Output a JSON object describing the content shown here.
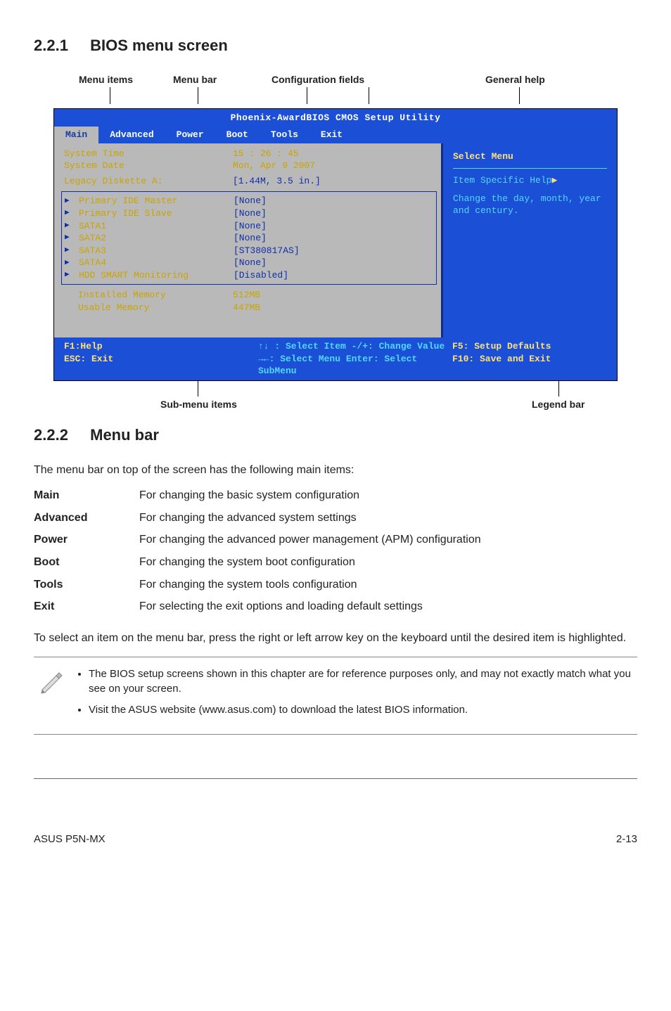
{
  "section_2_2_1": {
    "num": "2.2.1",
    "title": "BIOS menu screen"
  },
  "callouts": {
    "menu_items": "Menu items",
    "menu_bar": "Menu bar",
    "config_fields": "Configuration fields",
    "general_help": "General help",
    "sub_menu": "Sub-menu items",
    "legend": "Legend bar"
  },
  "bios": {
    "title": "Phoenix-AwardBIOS CMOS Setup Utility",
    "tabs": [
      "Main",
      "Advanced",
      "Power",
      "Boot",
      "Tools",
      "Exit"
    ],
    "rows": {
      "systime_k": "System Time",
      "systime_v": "15 : 26 : 45",
      "sysdate_k": "System Date",
      "sysdate_v": "Mon, Apr   9 2007",
      "legacy_k": "Legacy Diskette A:",
      "legacy_v": "[1.44M, 3.5 in.]",
      "pim_k": "Primary IDE Master",
      "pim_v": "[None]",
      "pis_k": "Primary IDE Slave",
      "pis_v": "[None]",
      "s1_k": "SATA1",
      "s1_v": "[None]",
      "s2_k": "SATA2",
      "s2_v": "[None]",
      "s3_k": "SATA3",
      "s3_v": "[ST380817AS]",
      "s4_k": "SATA4",
      "s4_v": "[None]",
      "hdd_k": "HDD SMART Monitoring",
      "hdd_v": "[Disabled]",
      "inst_k": "Installed Memory",
      "inst_v": "512MB",
      "use_k": "Usable Memory",
      "use_v": "447MB"
    },
    "help": {
      "header": "Select Menu",
      "line1": "Item Specific Help",
      "line2": "Change the day, month, year and century."
    },
    "foot": {
      "f1": "F1:Help",
      "esc": "ESC: Exit",
      "mid1": "↑↓ : Select Item  -/+: Change Value",
      "mid2": "→←: Select Menu  Enter: Select SubMenu",
      "r1": "F5: Setup Defaults",
      "r2": "F10: Save and Exit"
    }
  },
  "section_2_2_2": {
    "num": "2.2.2",
    "title": "Menu bar"
  },
  "para_intro": "The menu bar on top of the screen has the following main items:",
  "defs": [
    {
      "k": "Main",
      "v": "For changing the basic system configuration"
    },
    {
      "k": "Advanced",
      "v": "For changing the advanced system settings"
    },
    {
      "k": "Power",
      "v": "For changing the advanced power management (APM) configuration"
    },
    {
      "k": "Boot",
      "v": "For changing the system boot configuration"
    },
    {
      "k": "Tools",
      "v": "For changing the system tools configuration"
    },
    {
      "k": "Exit",
      "v": "For selecting the exit options and loading default settings"
    }
  ],
  "para_nav": "To select an item on the menu bar, press the right or left arrow key on the keyboard until the desired item is highlighted.",
  "notes": [
    "The BIOS setup screens shown in this chapter are for reference purposes only, and may not exactly match what you see on your screen.",
    "Visit the ASUS website (www.asus.com) to download the latest BIOS information."
  ],
  "footer": {
    "left": "ASUS P5N-MX",
    "right": "2-13"
  }
}
